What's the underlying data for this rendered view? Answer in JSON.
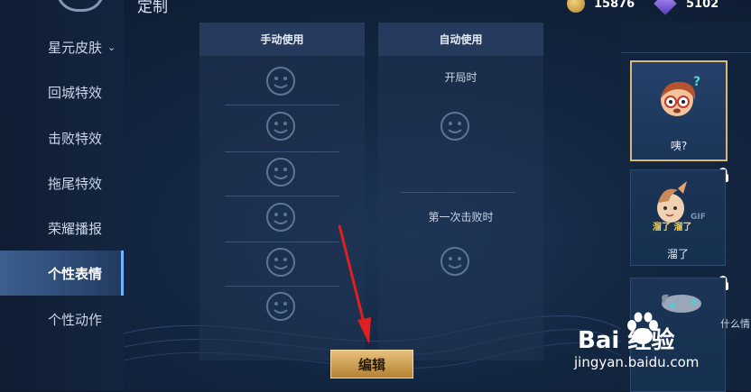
{
  "header": {
    "title": "定制"
  },
  "currency": [
    {
      "icon": "coin-icon",
      "value": "15876"
    },
    {
      "icon": "gem-icon",
      "value": "5102"
    }
  ],
  "sidebar": {
    "items": [
      {
        "label": "星元皮肤",
        "active": false,
        "has_chevron": true
      },
      {
        "label": "回城特效",
        "active": false
      },
      {
        "label": "击败特效",
        "active": false
      },
      {
        "label": "拖尾特效",
        "active": false
      },
      {
        "label": "荣耀播报",
        "active": false
      },
      {
        "label": "个性表情",
        "active": true
      },
      {
        "label": "个性动作",
        "active": false
      }
    ]
  },
  "panels": {
    "manual": {
      "title": "手动使用"
    },
    "auto": {
      "title": "自动使用",
      "triggers": [
        "开局时",
        "第一次击败时"
      ]
    }
  },
  "emotes": [
    {
      "label": "咦?",
      "selected": true,
      "locked": false
    },
    {
      "label": "溜了",
      "selected": false,
      "locked": true,
      "badge": "GIF",
      "caption": "溜了 溜了"
    },
    {
      "label": "",
      "selected": false,
      "locked": true
    }
  ],
  "side_text": "什么情",
  "edit_button": {
    "label": "编辑"
  },
  "watermark": {
    "brand": "Bai  经验",
    "url": "jingyan.baidu.com"
  },
  "colors": {
    "accent": "#6fb4ff",
    "button_gold": "#d4a955",
    "selected_border": "#d9b978"
  }
}
